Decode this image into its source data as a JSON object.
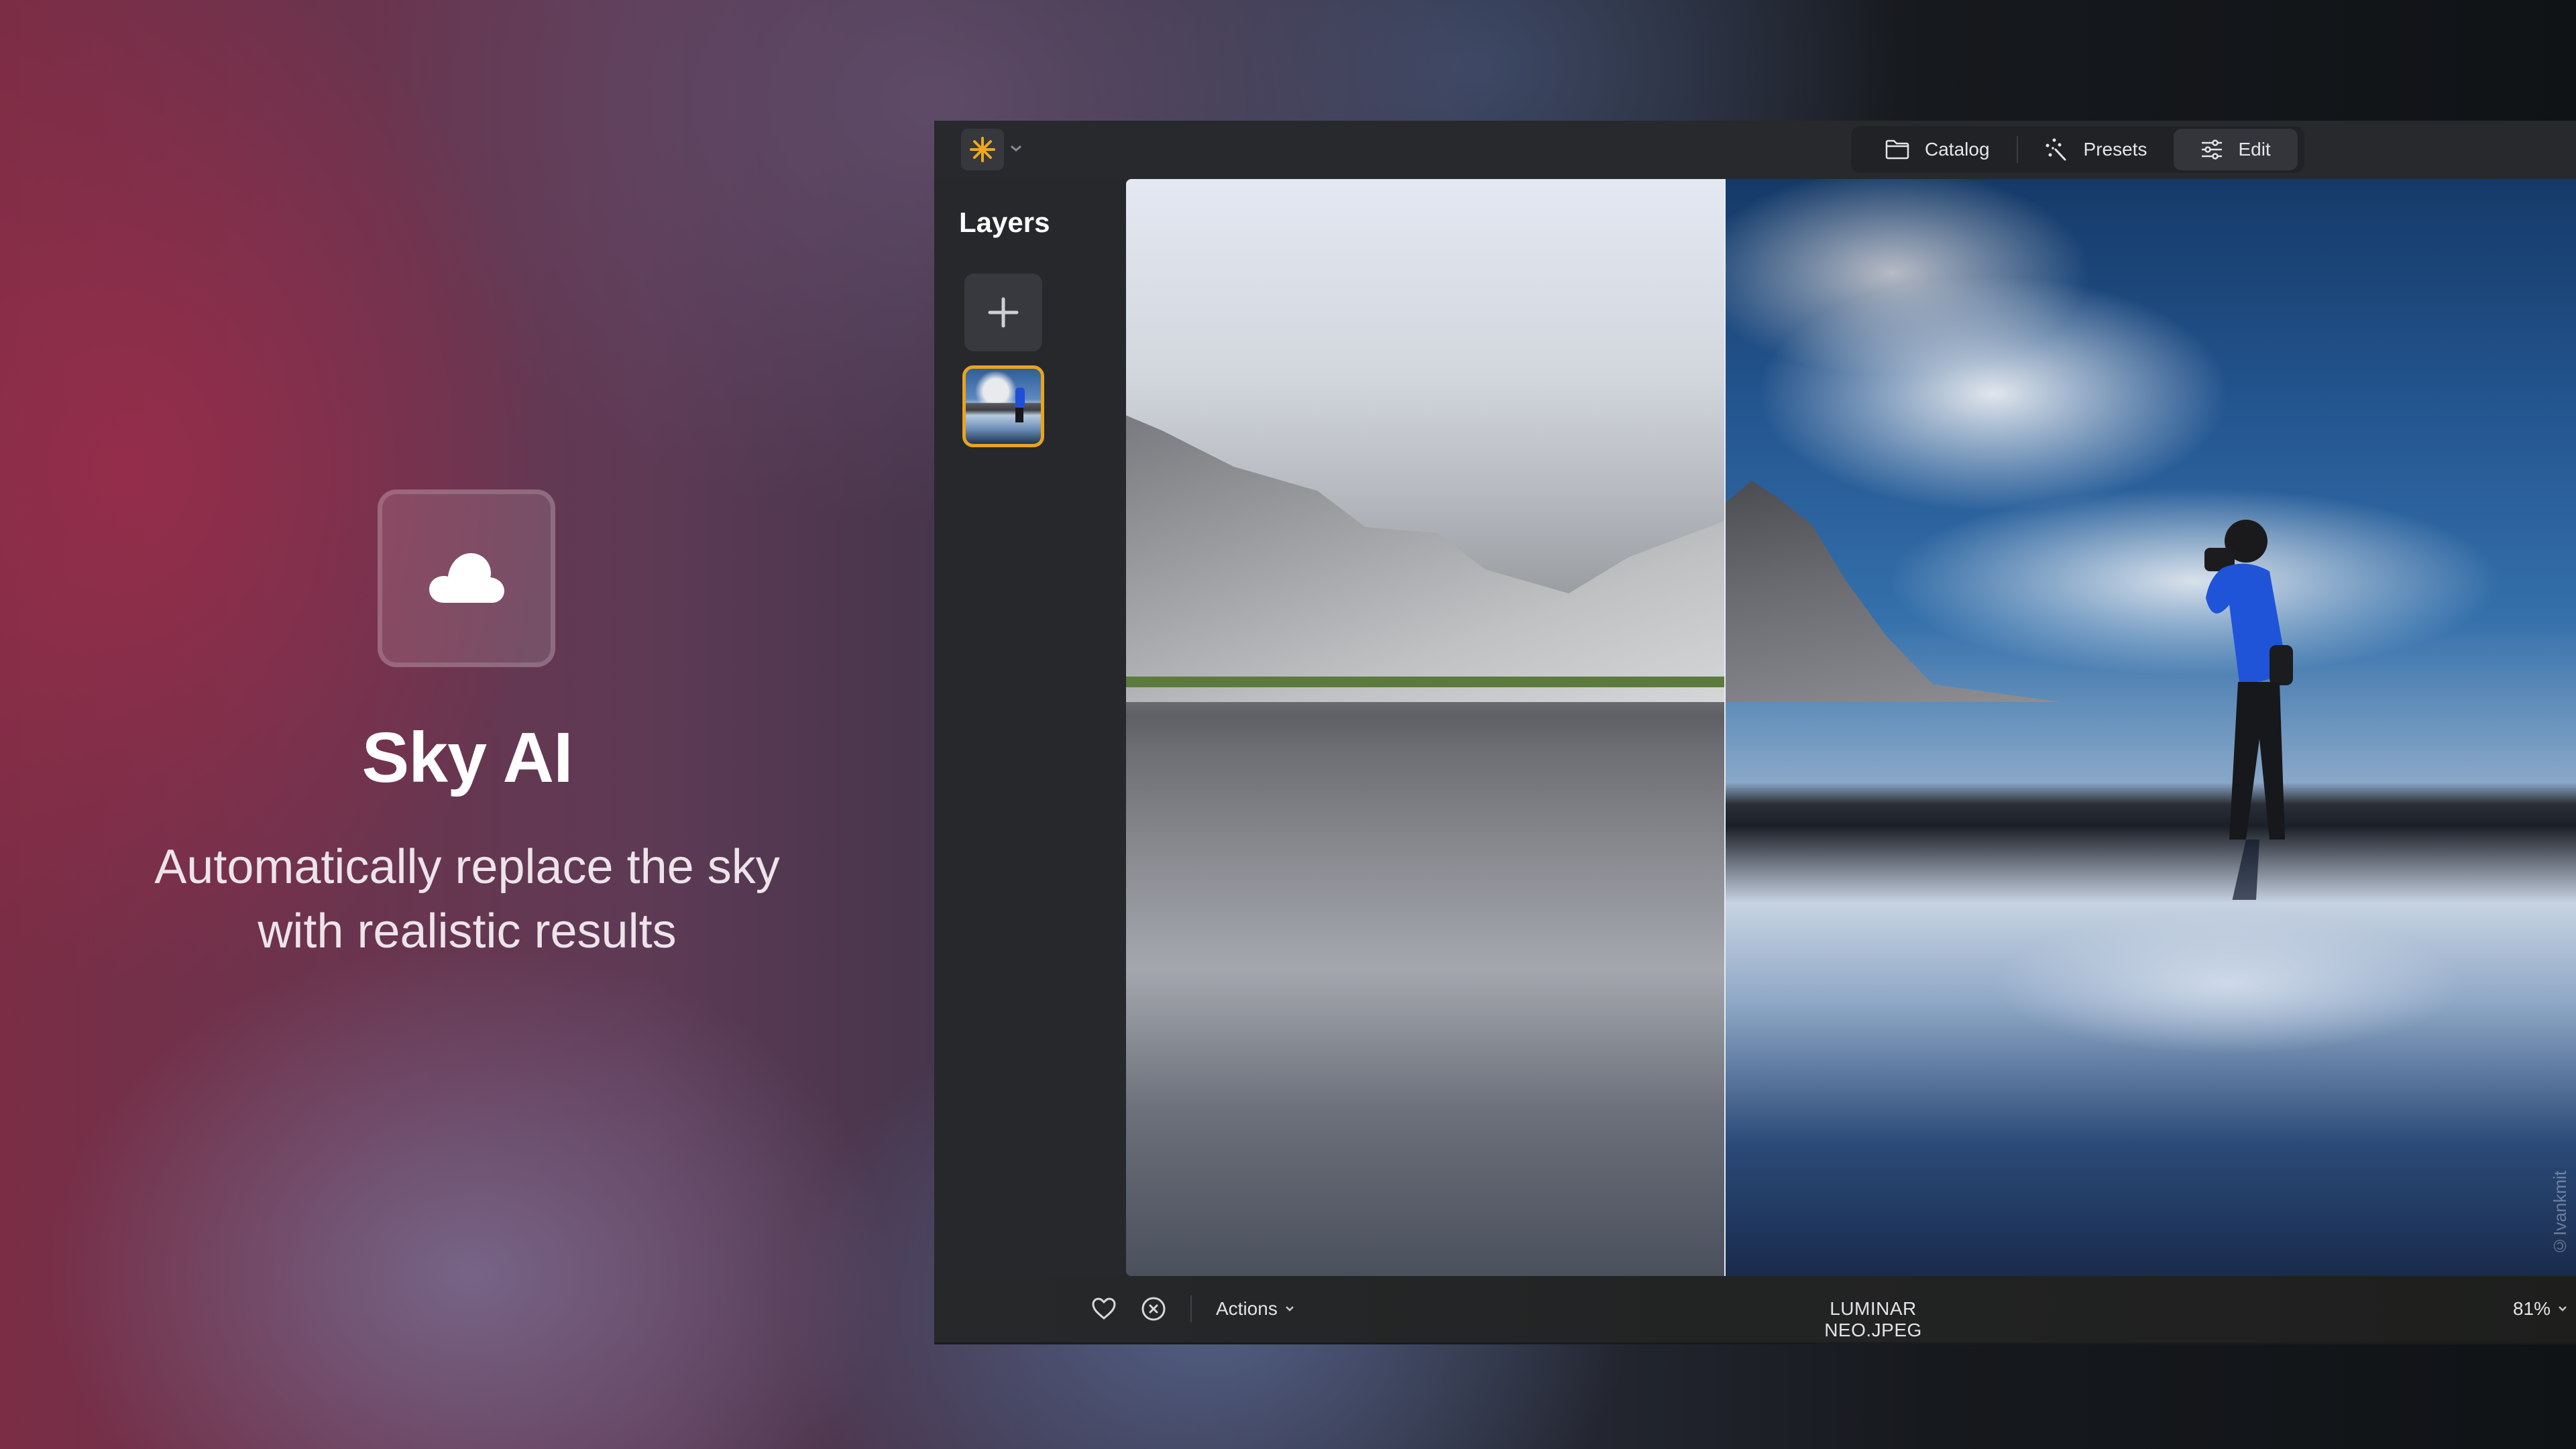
{
  "promo": {
    "icon": "cloud-icon",
    "title": "Sky AI",
    "subtitle_line1": "Automatically replace the sky",
    "subtitle_line2": "with realistic results"
  },
  "app": {
    "logo_icon": "luminar-star-icon",
    "accent_color": "#e8a321",
    "nav": [
      {
        "label": "Catalog",
        "icon": "folder-icon",
        "active": false
      },
      {
        "label": "Presets",
        "icon": "magic-wand-icon",
        "active": false
      },
      {
        "label": "Edit",
        "icon": "sliders-icon",
        "active": true
      }
    ],
    "layers": {
      "title": "Layers",
      "add_icon": "plus-icon"
    },
    "canvas": {
      "watermark": "©Ivankmit",
      "mode": "before-after split"
    },
    "bottom": {
      "favorite_icon": "heart-icon",
      "reject_icon": "circle-x-icon",
      "actions_label": "Actions",
      "filename": "LUMINAR NEO.JPEG",
      "zoom": "81%"
    }
  }
}
